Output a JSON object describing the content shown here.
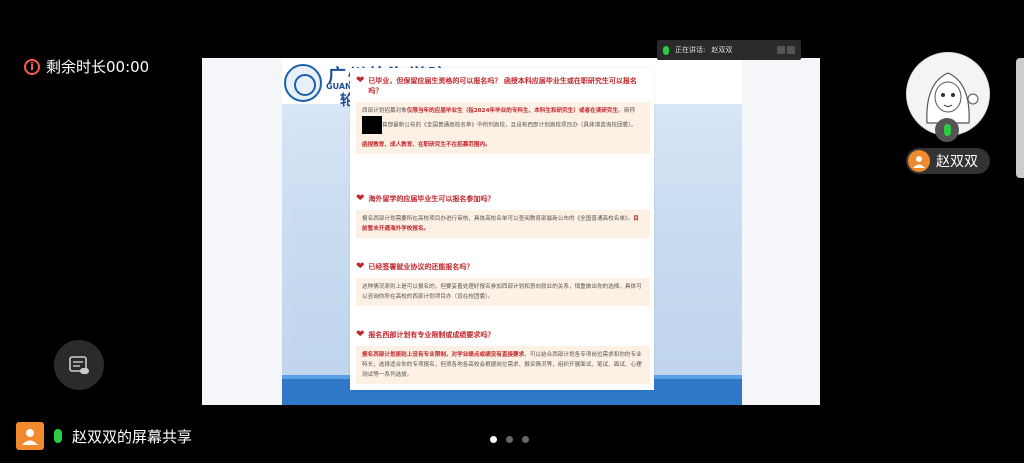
{
  "timer": {
    "label": "剩余时长00:00",
    "icon": "info-icon"
  },
  "speaking": {
    "prefix": "正在讲话:",
    "name": "赵双双"
  },
  "user": {
    "name": "赵双双"
  },
  "share": {
    "label": "赵双双的屏幕共享"
  },
  "pagination": {
    "count": 3,
    "active": 0
  },
  "slide": {
    "school_name": "广州航海学院",
    "school_en": "GUANGZ",
    "school_sub": "轮",
    "faq": [
      {
        "question": "已毕业，但保留应届生资格的可以报名吗？ 函授本科应届毕业生或在职研究生可以报名吗？",
        "answer": [
          {
            "t": "西部计划招募对象",
            "hl": false
          },
          {
            "t": "仅限当年的应届毕业生（指2024年毕业的专科生、本科生和研究生）或者在读研究生",
            "hl": true
          },
          {
            "t": "。简称",
            "hl": false
          },
          {
            "t": "REDACT",
            "hl": false
          },
          {
            "t": "育部最新公布的《全国普通高校名单》中所列高校，且设有西部计划高校项目办（具体请咨询校团委）。",
            "hl": false
          }
        ],
        "answer2": "函授教育、成人教育、在职研究生不在招募范围内。"
      },
      {
        "question": "海外留学的应届毕业生可以报名参加吗？",
        "answer": [
          {
            "t": "报名西部计划需要所在高校项目办进行审核，具体高校名单可以查阅教育部最新公布的《全国普通高校名单》。",
            "hl": false
          },
          {
            "t": "目前暂未开通海外学校报名。",
            "hl": true
          }
        ],
        "answer2": ""
      },
      {
        "question": "已经签署就业协议的还能报名吗？",
        "answer": [
          {
            "t": "这种情况原则上是可以报名的，但要妥善处理好报名参加西部计划和意向就业的关系，慎重做出你的选择。具体可以咨询你所在高校的西部计划项目办（设在校团委）。",
            "hl": false
          }
        ],
        "answer2": ""
      },
      {
        "question": "报名西部计划有专业限制或成绩要求吗？",
        "answer": [
          {
            "t": "报名西部计划原则上没有专业限制，对学业绩点或绩没有直接要求",
            "hl": true
          },
          {
            "t": "。可以结合西部计划各专项岗位需求和你的专业特长，选择适合你的专项报名，但须各地各高校会根据岗位需求、报名情况等，组织开展面试、笔试、面试、心理测试等一系列选拔。",
            "hl": false
          }
        ],
        "answer2": ""
      }
    ]
  },
  "colors": {
    "accent_red": "#c0262b",
    "mic_green": "#2ecc40",
    "user_orange": "#f08a2c",
    "timer_red": "#ff5a4d"
  }
}
